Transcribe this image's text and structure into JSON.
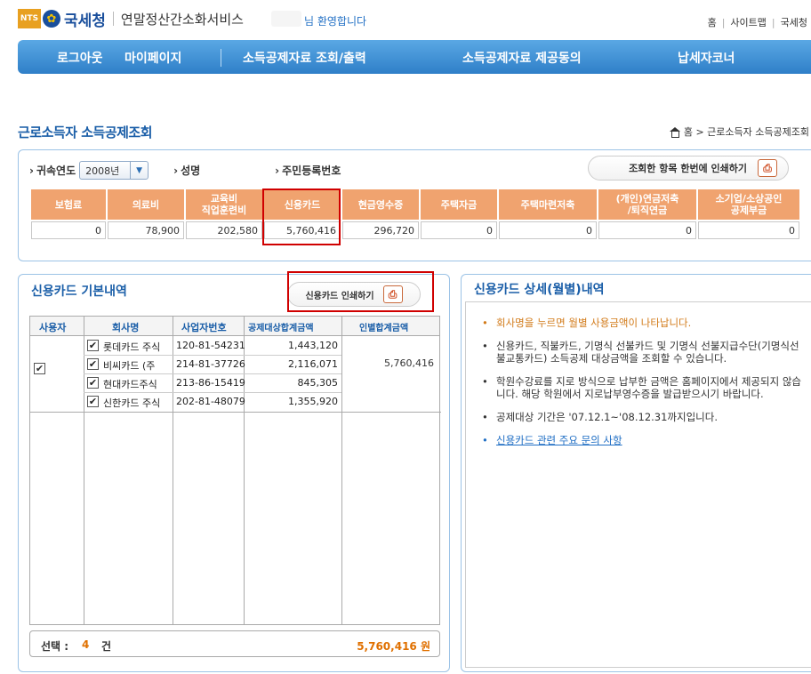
{
  "header": {
    "nts_badge": "NTS",
    "brand": "국세청",
    "service_name": "연말정산간소화서비스",
    "welcome": "님 환영합니다",
    "links": [
      "홈",
      "사이트맵",
      "국세청"
    ]
  },
  "nav": {
    "items": [
      "로그아웃",
      "마이페이지",
      "소득공제자료 조회/출력",
      "소득공제자료 제공동의",
      "납세자코너"
    ]
  },
  "page": {
    "title": "근로소득자 소득공제조회",
    "breadcrumb": "홈 > 근로소득자 소득공제조회"
  },
  "filters": {
    "year_label": "귀속연도",
    "year_value": "2008년",
    "name_label": "성명",
    "rrn_label": "주민등록번호",
    "print_all_label": "조회한 항목 한번에 인쇄하기"
  },
  "summary": {
    "headers": [
      "보험료",
      "의료비",
      "교육비\n직업훈련비",
      "신용카드",
      "현금영수증",
      "주택자금",
      "주택마련저축",
      "(개인)연금저축\n/퇴직연금",
      "소기업/소상공인\n공제부금"
    ],
    "values": [
      "0",
      "78,900",
      "202,580",
      "5,760,416",
      "296,720",
      "0",
      "0",
      "0",
      "0"
    ]
  },
  "card_panel": {
    "title": "신용카드 기본내역",
    "print_label": "신용카드 인쇄하기",
    "columns": [
      "사용자",
      "회사명",
      "사업자번호",
      "공제대상합계금액",
      "인별합계금액"
    ],
    "rows": [
      {
        "company": "롯데카드 주식",
        "bizno": "120-81-54231",
        "amount": "1,443,120"
      },
      {
        "company": "비씨카드 (주",
        "bizno": "214-81-37726",
        "amount": "2,116,071"
      },
      {
        "company": "현대카드주식",
        "bizno": "213-86-15419",
        "amount": "845,305"
      },
      {
        "company": "신한카드 주식",
        "bizno": "202-81-48079",
        "amount": "1,355,920"
      }
    ],
    "person_total": "5,760,416",
    "select_label": "선택 :",
    "select_count": "4",
    "select_unit": "건",
    "select_total": "5,760,416 원"
  },
  "detail_panel": {
    "title": "신용카드 상세(월별)내역",
    "notes": [
      "회사명을 누르면 월별 사용금액이 나타납니다.",
      "신용카드, 직불카드, 기명식 선불카드 및 기명식 선불지급수단(기명식선불교통카드) 소득공제 대상금액을 조회할 수 있습니다.",
      "학원수강료를 지로 방식으로 납부한 금액은 홈페이지에서 제공되지 않습니다. 해당 학원에서 지로납부영수증을 발급받으시기 바랍니다.",
      "공제대상 기간은 '07.12.1~'08.12.31까지입니다.",
      "신용카드 관련 주요 문의 사항"
    ]
  }
}
